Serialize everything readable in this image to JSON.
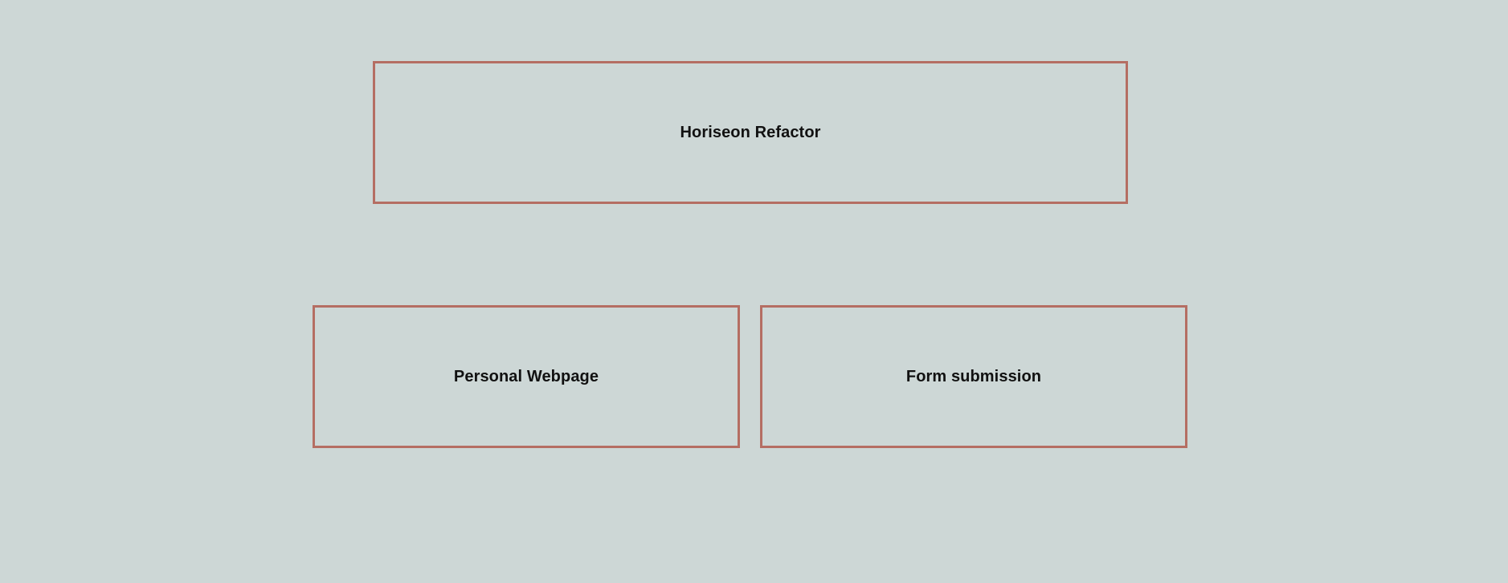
{
  "projects": [
    {
      "title": "Horiseon Refactor"
    },
    {
      "title": "Personal Webpage"
    },
    {
      "title": "Form submission"
    }
  ],
  "colors": {
    "background": "#cdd7d6",
    "border": "#b56e63",
    "text": "#111111"
  }
}
